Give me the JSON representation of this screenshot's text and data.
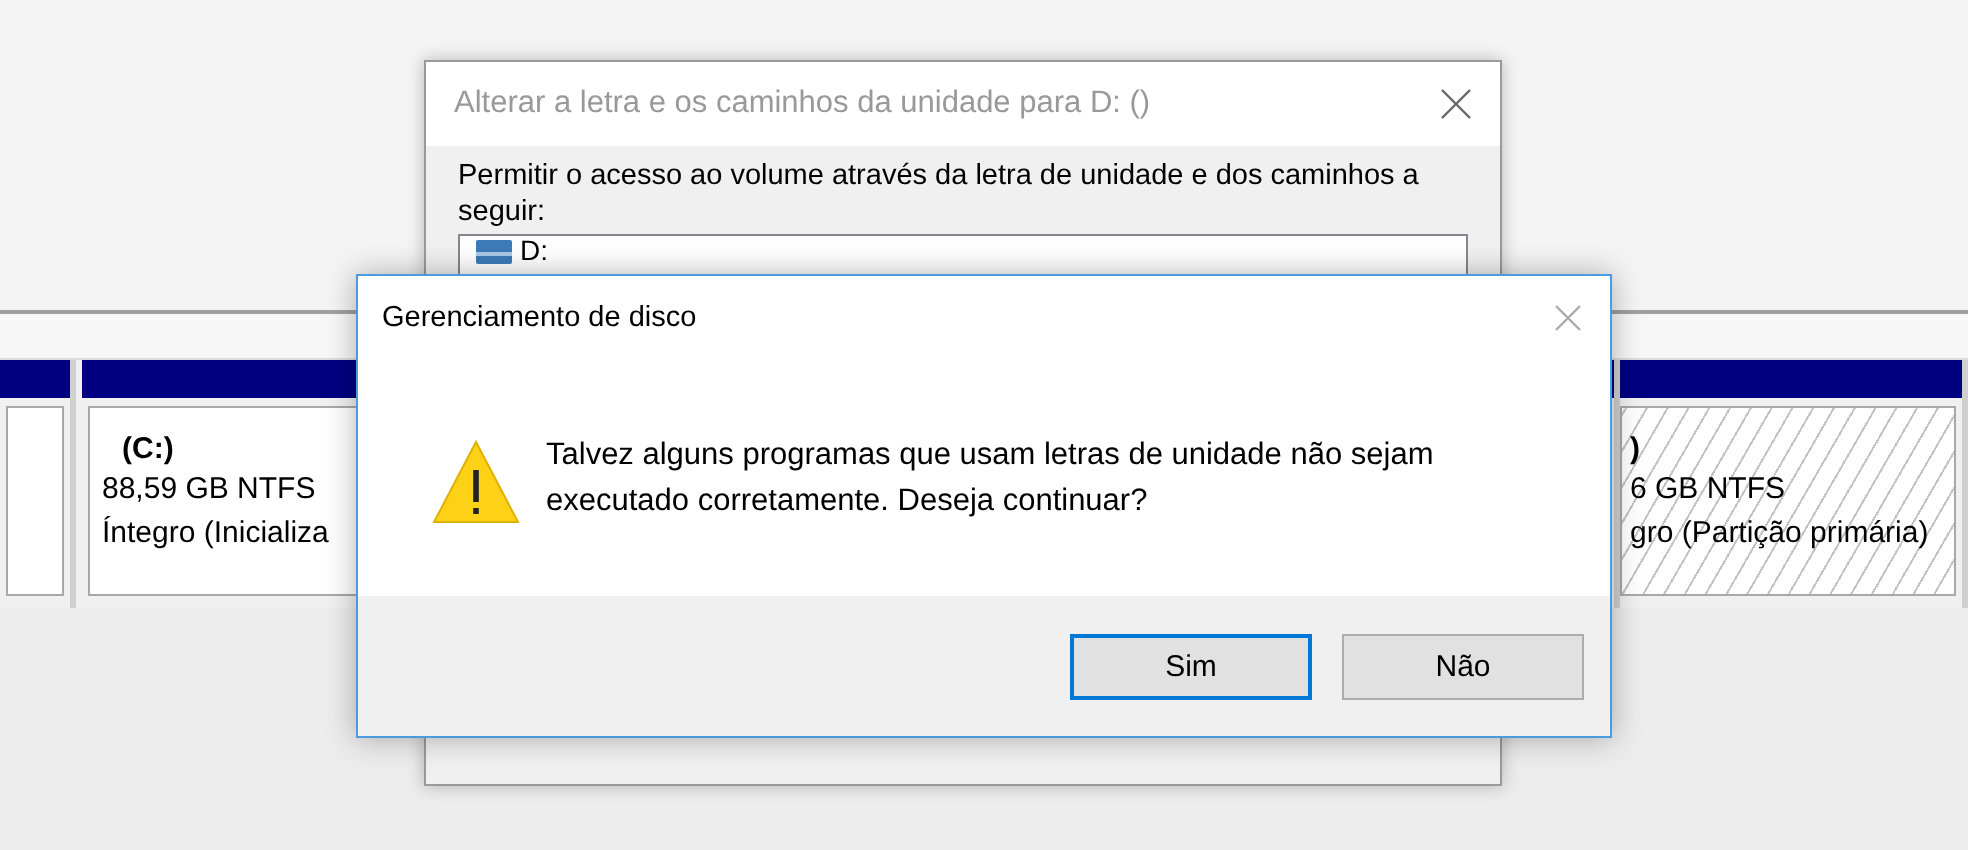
{
  "disk_map": {
    "partitions": [
      {
        "selected": false
      },
      {
        "selected": false,
        "name": "(C:)",
        "size": "88,59 GB NTFS",
        "status": "Íntegro (Inicializa"
      },
      {
        "selected": true,
        "name": ")",
        "size": "6 GB NTFS",
        "status": "gro (Partição primária)"
      }
    ]
  },
  "change_letter_dialog": {
    "title": "Alterar a letra e os caminhos da unidade para D: ()",
    "instruction": "Permitir o acesso ao volume através da letra de unidade e dos caminhos a seguir:",
    "paths": [
      {
        "label": "D:"
      }
    ]
  },
  "confirm_dialog": {
    "title": "Gerenciamento de disco",
    "message": "Talvez alguns programas que usam letras de unidade não sejam executado corretamente. Deseja continuar?",
    "buttons": [
      {
        "label": "Sim",
        "default": true
      },
      {
        "label": "Não",
        "default": false
      }
    ]
  }
}
